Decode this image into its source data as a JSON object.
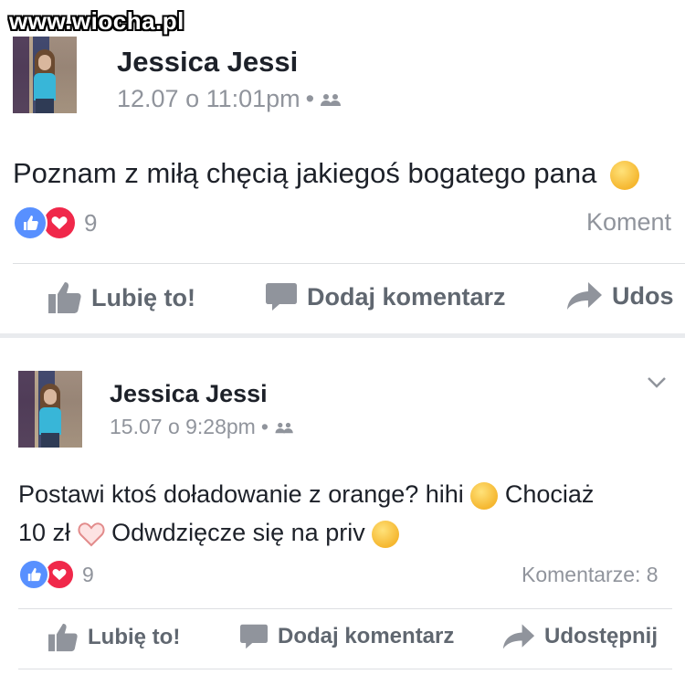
{
  "watermark": "www.wiocha.pl",
  "posts": [
    {
      "author": "Jessica Jessi",
      "timestamp": "12.07 o 11:01pm",
      "text": "Poznam z miłą chęcią jakiegoś bogatego pana",
      "reaction_count": "9",
      "comments_label": "Koment",
      "actions": {
        "like": "Lubię to!",
        "comment": "Dodaj komentarz",
        "share": "Udos"
      }
    },
    {
      "author": "Jessica Jessi",
      "timestamp": "15.07 o 9:28pm",
      "text_line1_a": "Postawi ktoś doładowanie z orange? hihi",
      "text_line1_b": "Chociaż",
      "text_line2_a": "10 zł",
      "text_line2_b": "Odwdzięcze się na priv",
      "reaction_count": "9",
      "comments_label": "Komentarze: 8",
      "actions": {
        "like": "Lubię to!",
        "comment": "Dodaj komentarz",
        "share": "Udostępnij"
      }
    }
  ],
  "icons": {
    "audience": "friends-icon",
    "like_reaction": "thumbs-up-icon",
    "love_reaction": "heart-icon",
    "emoji_kiss": "kissing-face-emoji",
    "emoji_heart": "heart-emoji",
    "menu": "chevron-down-icon"
  },
  "colors": {
    "like_blue": "#5890ff",
    "love_red": "#f0284a",
    "meta_gray": "#90949c",
    "action_gray": "#606770"
  }
}
